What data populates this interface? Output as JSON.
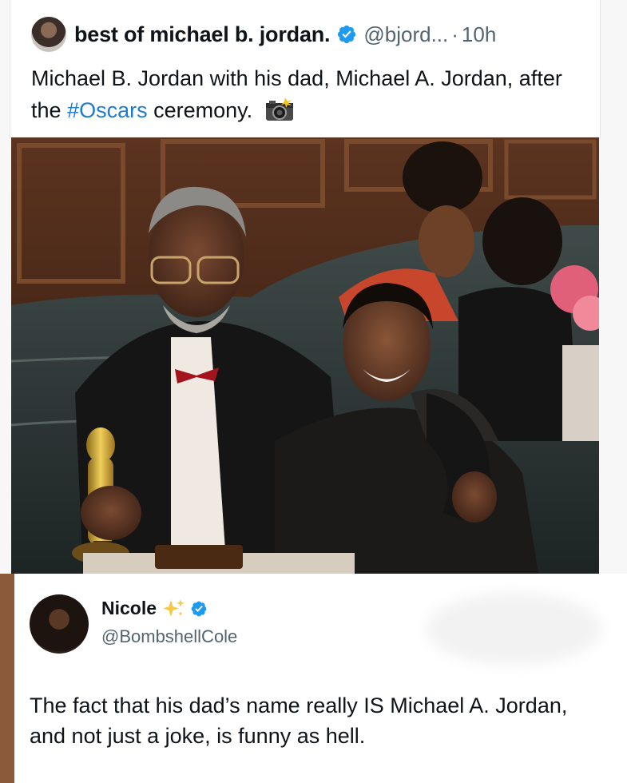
{
  "quoted_tweet": {
    "display_name": "best of michael b. jordan.",
    "handle": "@bjord...",
    "separator": "·",
    "time": "10h",
    "text_before": "Michael B. Jordan with his dad, Michael A. Jordan, after the ",
    "hashtag": "#Oscars",
    "text_after": " ceremony.",
    "emoji_icon": "camera-flash-icon"
  },
  "reply": {
    "display_name": "Nicole",
    "emoji_icon": "sparkles-icon",
    "handle": "@BombshellCole",
    "text": "The fact that his dad’s name really IS Michael A. Jordan, and not just a joke, is funny as hell."
  },
  "colors": {
    "verified": "#1d9bf0",
    "hashtag": "#1d7bd8",
    "secondary_text": "#536471"
  }
}
